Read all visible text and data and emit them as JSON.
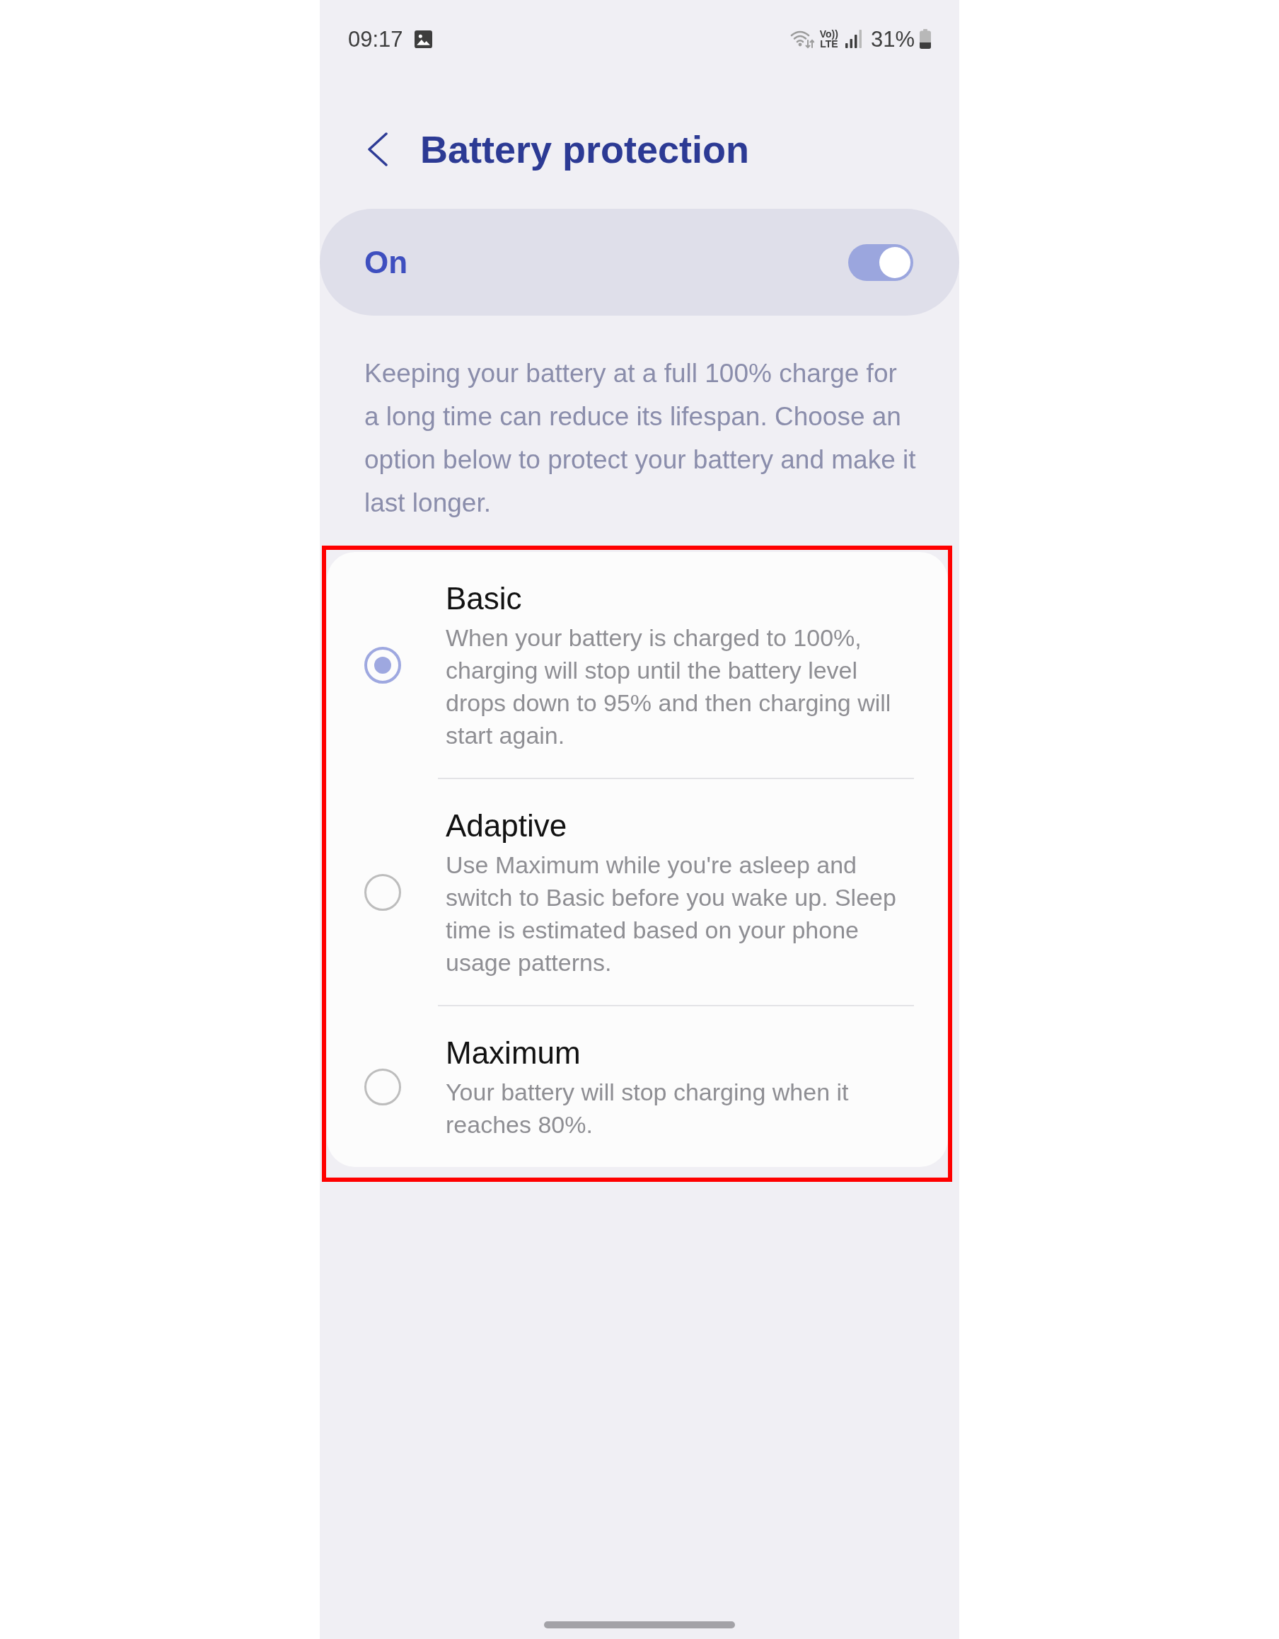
{
  "status_bar": {
    "time": "09:17",
    "volte": "Vo))",
    "network": "LTE",
    "battery": "31%"
  },
  "header": {
    "title": "Battery protection"
  },
  "master_switch": {
    "label": "On",
    "on": true
  },
  "description": "Keeping your battery at a full 100% charge for a long time can reduce its lifespan. Choose an option below to protect your battery and make it last longer.",
  "options": {
    "highlighted": true,
    "items": [
      {
        "title": "Basic",
        "description": "When your battery is charged to 100%, charging will stop until the battery level drops down to 95% and then charging will start again.",
        "selected": true
      },
      {
        "title": "Adaptive",
        "description": "Use Maximum while you're asleep and switch to Basic before you wake up. Sleep time is estimated based on your phone usage patterns.",
        "selected": false
      },
      {
        "title": "Maximum",
        "description": "Your battery will stop charging when it reaches 80%.",
        "selected": false
      }
    ]
  }
}
